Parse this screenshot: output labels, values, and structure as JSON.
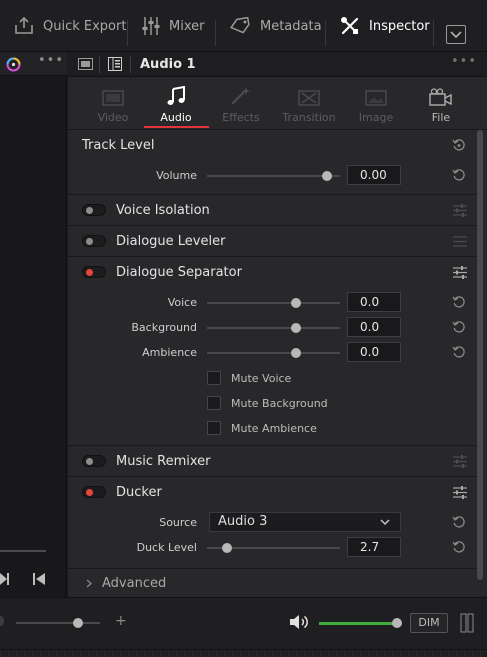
{
  "toolbar": {
    "quick_export": "Quick Export",
    "mixer": "Mixer",
    "metadata": "Metadata",
    "inspector": "Inspector"
  },
  "inspector": {
    "clip_title": "Audio 1",
    "tabs": [
      {
        "label": "Video",
        "icon": "film-icon",
        "state": "disabled"
      },
      {
        "label": "Audio",
        "icon": "music-note-icon",
        "state": "active"
      },
      {
        "label": "Effects",
        "icon": "magic-wand-icon",
        "state": "disabled"
      },
      {
        "label": "Transition",
        "icon": "transition-icon",
        "state": "disabled"
      },
      {
        "label": "Image",
        "icon": "image-icon",
        "state": "disabled"
      },
      {
        "label": "File",
        "icon": "camera-icon",
        "state": "enabled"
      }
    ],
    "track_level": {
      "title": "Track Level",
      "volume_label": "Volume",
      "volume_value": "0.00",
      "volume_slider": 0.9
    },
    "voice_isolation": {
      "title": "Voice Isolation",
      "enabled": false
    },
    "dialogue_leveler": {
      "title": "Dialogue Leveler",
      "enabled": false
    },
    "dialogue_separator": {
      "title": "Dialogue Separator",
      "enabled": true,
      "params": [
        {
          "label": "Voice",
          "value": "0.0",
          "slider": 0.67
        },
        {
          "label": "Background",
          "value": "0.0",
          "slider": 0.67
        },
        {
          "label": "Ambience",
          "value": "0.0",
          "slider": 0.67
        }
      ],
      "checkboxes": [
        {
          "label": "Mute Voice",
          "checked": false
        },
        {
          "label": "Mute Background",
          "checked": false
        },
        {
          "label": "Mute Ambience",
          "checked": false
        }
      ]
    },
    "music_remixer": {
      "title": "Music Remixer",
      "enabled": false
    },
    "ducker": {
      "title": "Ducker",
      "enabled": true,
      "source_label": "Source",
      "source_value": "Audio 3",
      "duck_level_label": "Duck Level",
      "duck_level_value": "2.7",
      "duck_level_slider": 0.15
    },
    "advanced": {
      "title": "Advanced"
    }
  },
  "bottom": {
    "zoom_plus": "+",
    "dim_label": "DIM",
    "master_volume_level": 0.95
  },
  "colors": {
    "accent_red": "#e0353b",
    "toggle_on": "#e8453c",
    "meter_green": "#3fae3f"
  }
}
